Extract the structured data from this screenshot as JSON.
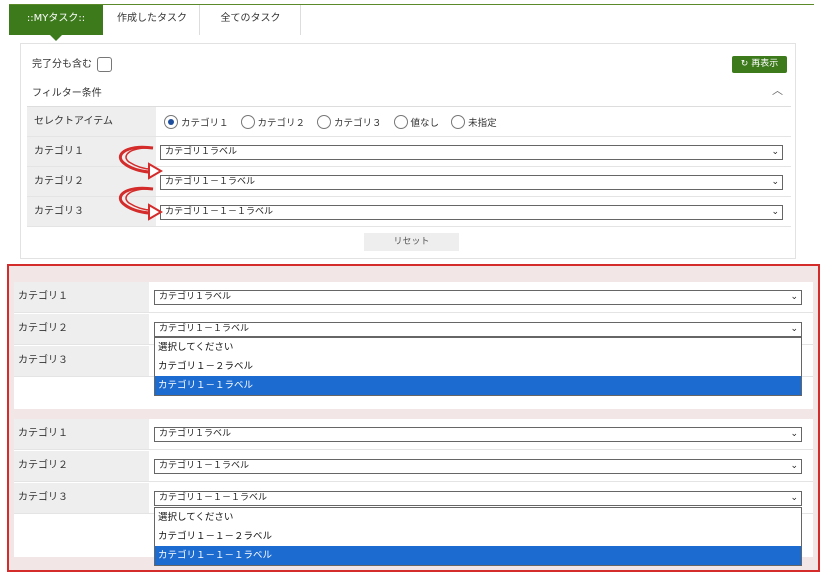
{
  "tabs": [
    {
      "label": "::MYタスク::",
      "active": true
    },
    {
      "label": "作成したタスク",
      "active": false
    },
    {
      "label": "全てのタスク",
      "active": false
    }
  ],
  "filter": {
    "include_completed_label": "完了分も含む",
    "reload_label": "再表示",
    "title": "フィルター条件",
    "collapse_icon": "chevron-up-icon",
    "select_item_label": "セレクトアイテム",
    "radio_options": [
      "カテゴリ１",
      "カテゴリ２",
      "カテゴリ３",
      "値なし",
      "未指定"
    ],
    "radio_selected": "カテゴリ１",
    "rows": [
      {
        "label": "カテゴリ１",
        "value": "カテゴリ１ラベル"
      },
      {
        "label": "カテゴリ２",
        "value": "カテゴリ１－１ラベル"
      },
      {
        "label": "カテゴリ３",
        "value": "カテゴリ１－１－１ラベル"
      }
    ],
    "reset_label": "リセット"
  },
  "panel1": {
    "rows": [
      {
        "label": "カテゴリ１",
        "value": "カテゴリ１ラベル"
      },
      {
        "label": "カテゴリ２",
        "value": "カテゴリ１－１ラベル"
      },
      {
        "label": "カテゴリ３",
        "value": ""
      }
    ],
    "dropdown_options": [
      "選択してください",
      "カテゴリ１－２ラベル",
      "カテゴリ１－１ラベル"
    ],
    "dropdown_selected_index": 2
  },
  "panel2": {
    "rows": [
      {
        "label": "カテゴリ１",
        "value": "カテゴリ１ラベル"
      },
      {
        "label": "カテゴリ２",
        "value": "カテゴリ１－１ラベル"
      },
      {
        "label": "カテゴリ３",
        "value": "カテゴリ１－１－１ラベル"
      }
    ],
    "dropdown_options": [
      "選択してください",
      "カテゴリ１－１－２ラベル",
      "カテゴリ１－１－１ラベル"
    ],
    "dropdown_selected_index": 2
  },
  "colors": {
    "accent": "#3c7a1c",
    "highlight": "#1c6bd1",
    "annotation": "#d42b2b"
  }
}
